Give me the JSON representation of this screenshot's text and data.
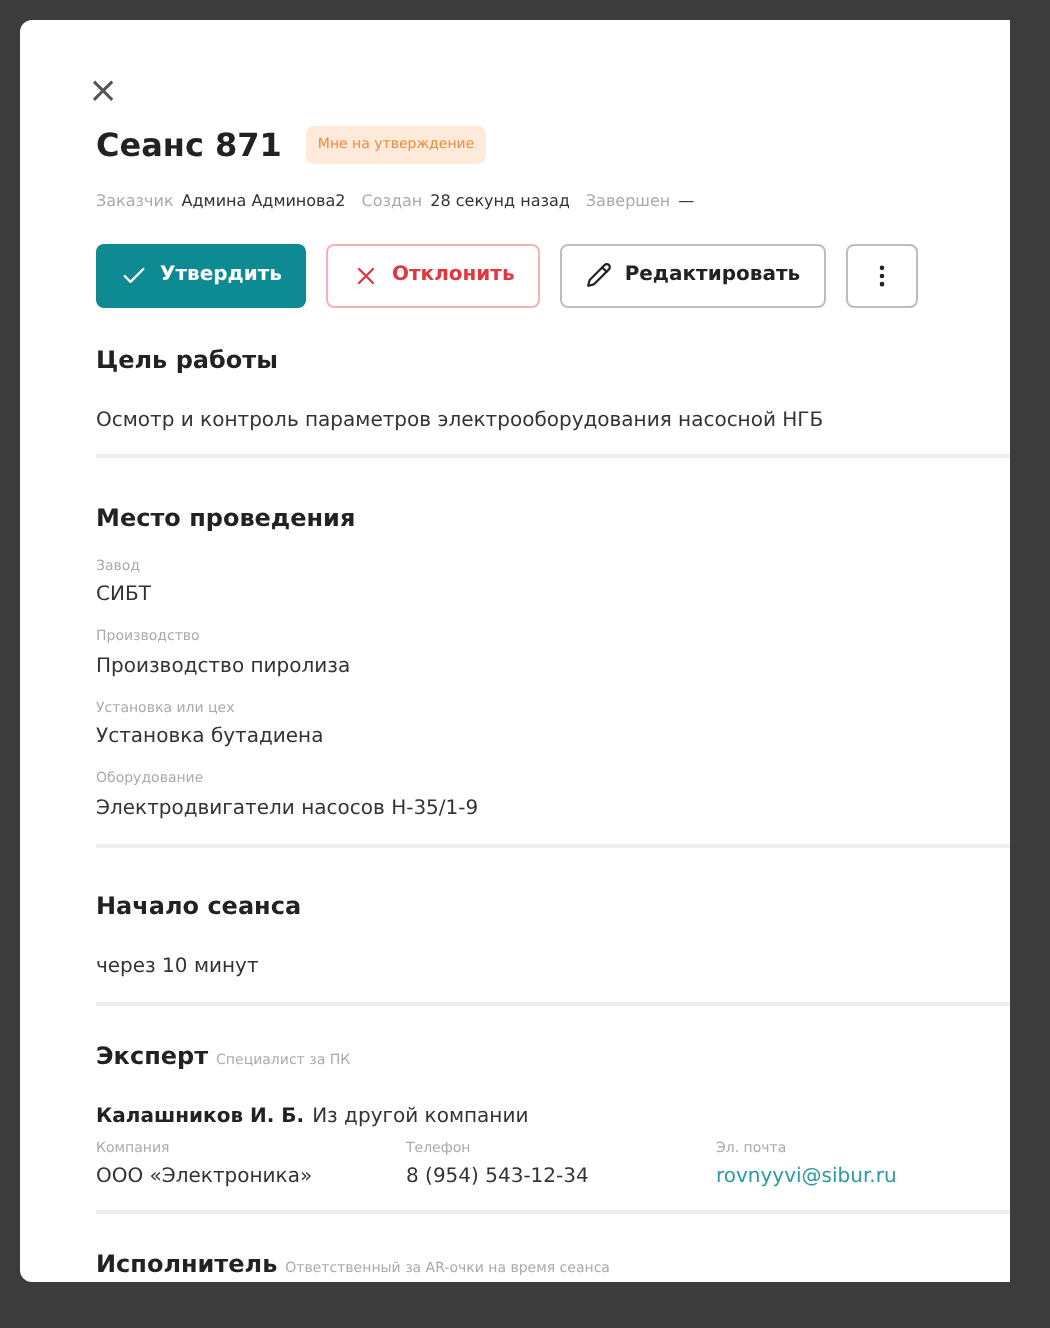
{
  "close": "×",
  "title": "Сеанс 871",
  "status_badge": "Мне на утверждение",
  "meta": [
    {
      "label": "Заказчик",
      "value": "Админа Админова2"
    },
    {
      "label": "Создан",
      "value": "28 секунд назад"
    },
    {
      "label": "Завершен",
      "value": "—"
    }
  ],
  "actions": [
    {
      "kind": "approve",
      "label": "Утвердить"
    },
    {
      "kind": "reject",
      "label": "Отклонить"
    },
    {
      "kind": "edit",
      "label": "Редактировать"
    },
    {
      "kind": "more"
    }
  ],
  "goal": {
    "heading": "Цель работы",
    "text": "Осмотр и контроль параметров электрооборудования насосной НГБ"
  },
  "location": {
    "heading": "Место проведения",
    "fields": [
      {
        "label": "Завод",
        "value": "СИБТ"
      },
      {
        "label": "Производство",
        "value": "Производство пиролиза"
      },
      {
        "label": "Установка или цех",
        "value": "Установка бутадиена"
      },
      {
        "label": "Оборудование",
        "value": "Электродвигатели насосов Н-35/1-9"
      }
    ]
  },
  "start": {
    "heading": "Начало сеанса",
    "text": "через 10 минут"
  },
  "expert": {
    "heading": "Эксперт",
    "subtitle": "Специалист за ПК",
    "name": "Калашников И. Б.",
    "affiliation": "Из другой компании",
    "contacts": [
      {
        "kind": "text",
        "label": "Компания",
        "value": "ООО «Электроника»"
      },
      {
        "kind": "text",
        "label": "Телефон",
        "value": "8 (954) 543-12-34"
      },
      {
        "kind": "email",
        "label": "Эл. почта",
        "value": "rovnyyvi@sibur.ru"
      }
    ]
  },
  "executor": {
    "heading": "Исполнитель",
    "subtitle": "Ответственный за АR-очки на время сеанса"
  }
}
